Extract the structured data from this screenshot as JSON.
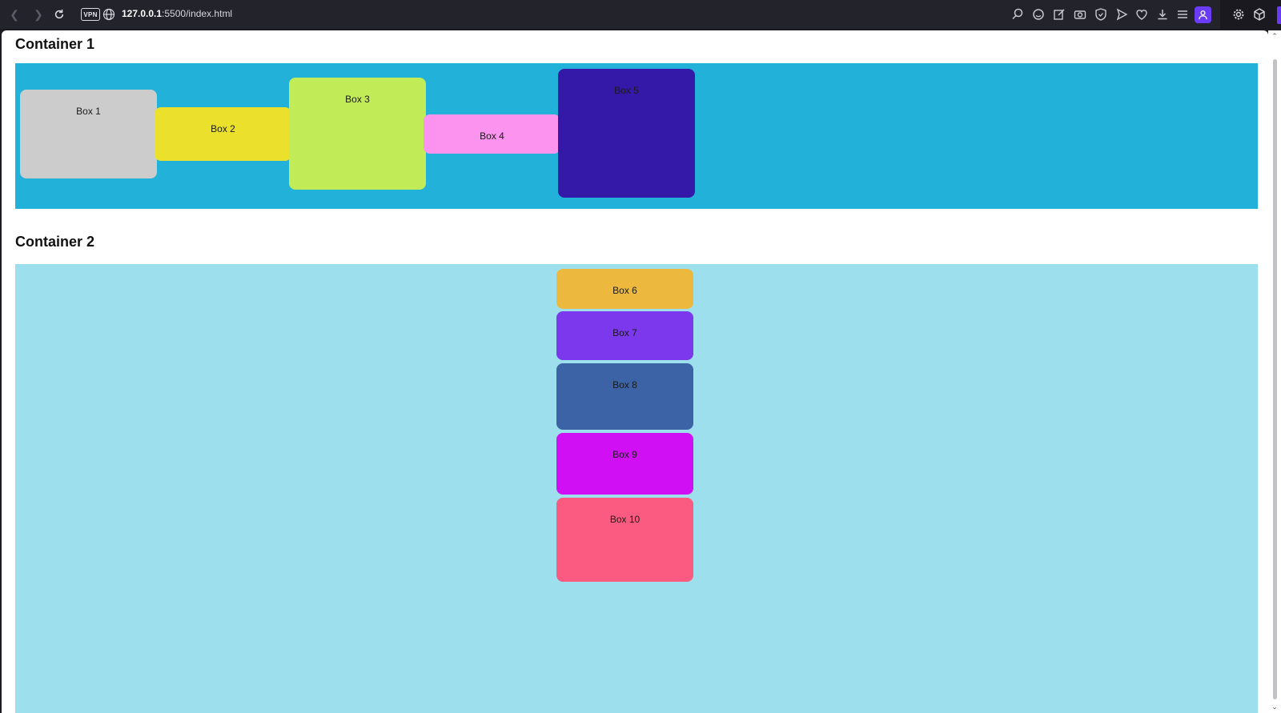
{
  "browser": {
    "url_host": "127.0.0.1",
    "url_path": ":5500/index.html",
    "vpn_label": "VPN"
  },
  "page": {
    "container1": {
      "title": "Container 1",
      "boxes": [
        {
          "label": "Box 1",
          "color": "#cccccc"
        },
        {
          "label": "Box 2",
          "color": "#ebe02b"
        },
        {
          "label": "Box 3",
          "color": "#c2eb58"
        },
        {
          "label": "Box 4",
          "color": "#fb93ef"
        },
        {
          "label": "Box 5",
          "color": "#3418a8"
        }
      ]
    },
    "container2": {
      "title": "Container 2",
      "boxes": [
        {
          "label": "Box 6",
          "color": "#ecb93e"
        },
        {
          "label": "Box 7",
          "color": "#7b38ed"
        },
        {
          "label": "Box 8",
          "color": "#3b63a6"
        },
        {
          "label": "Box 9",
          "color": "#d00ff4"
        },
        {
          "label": "Box 10",
          "color": "#fb5b80"
        }
      ]
    }
  }
}
